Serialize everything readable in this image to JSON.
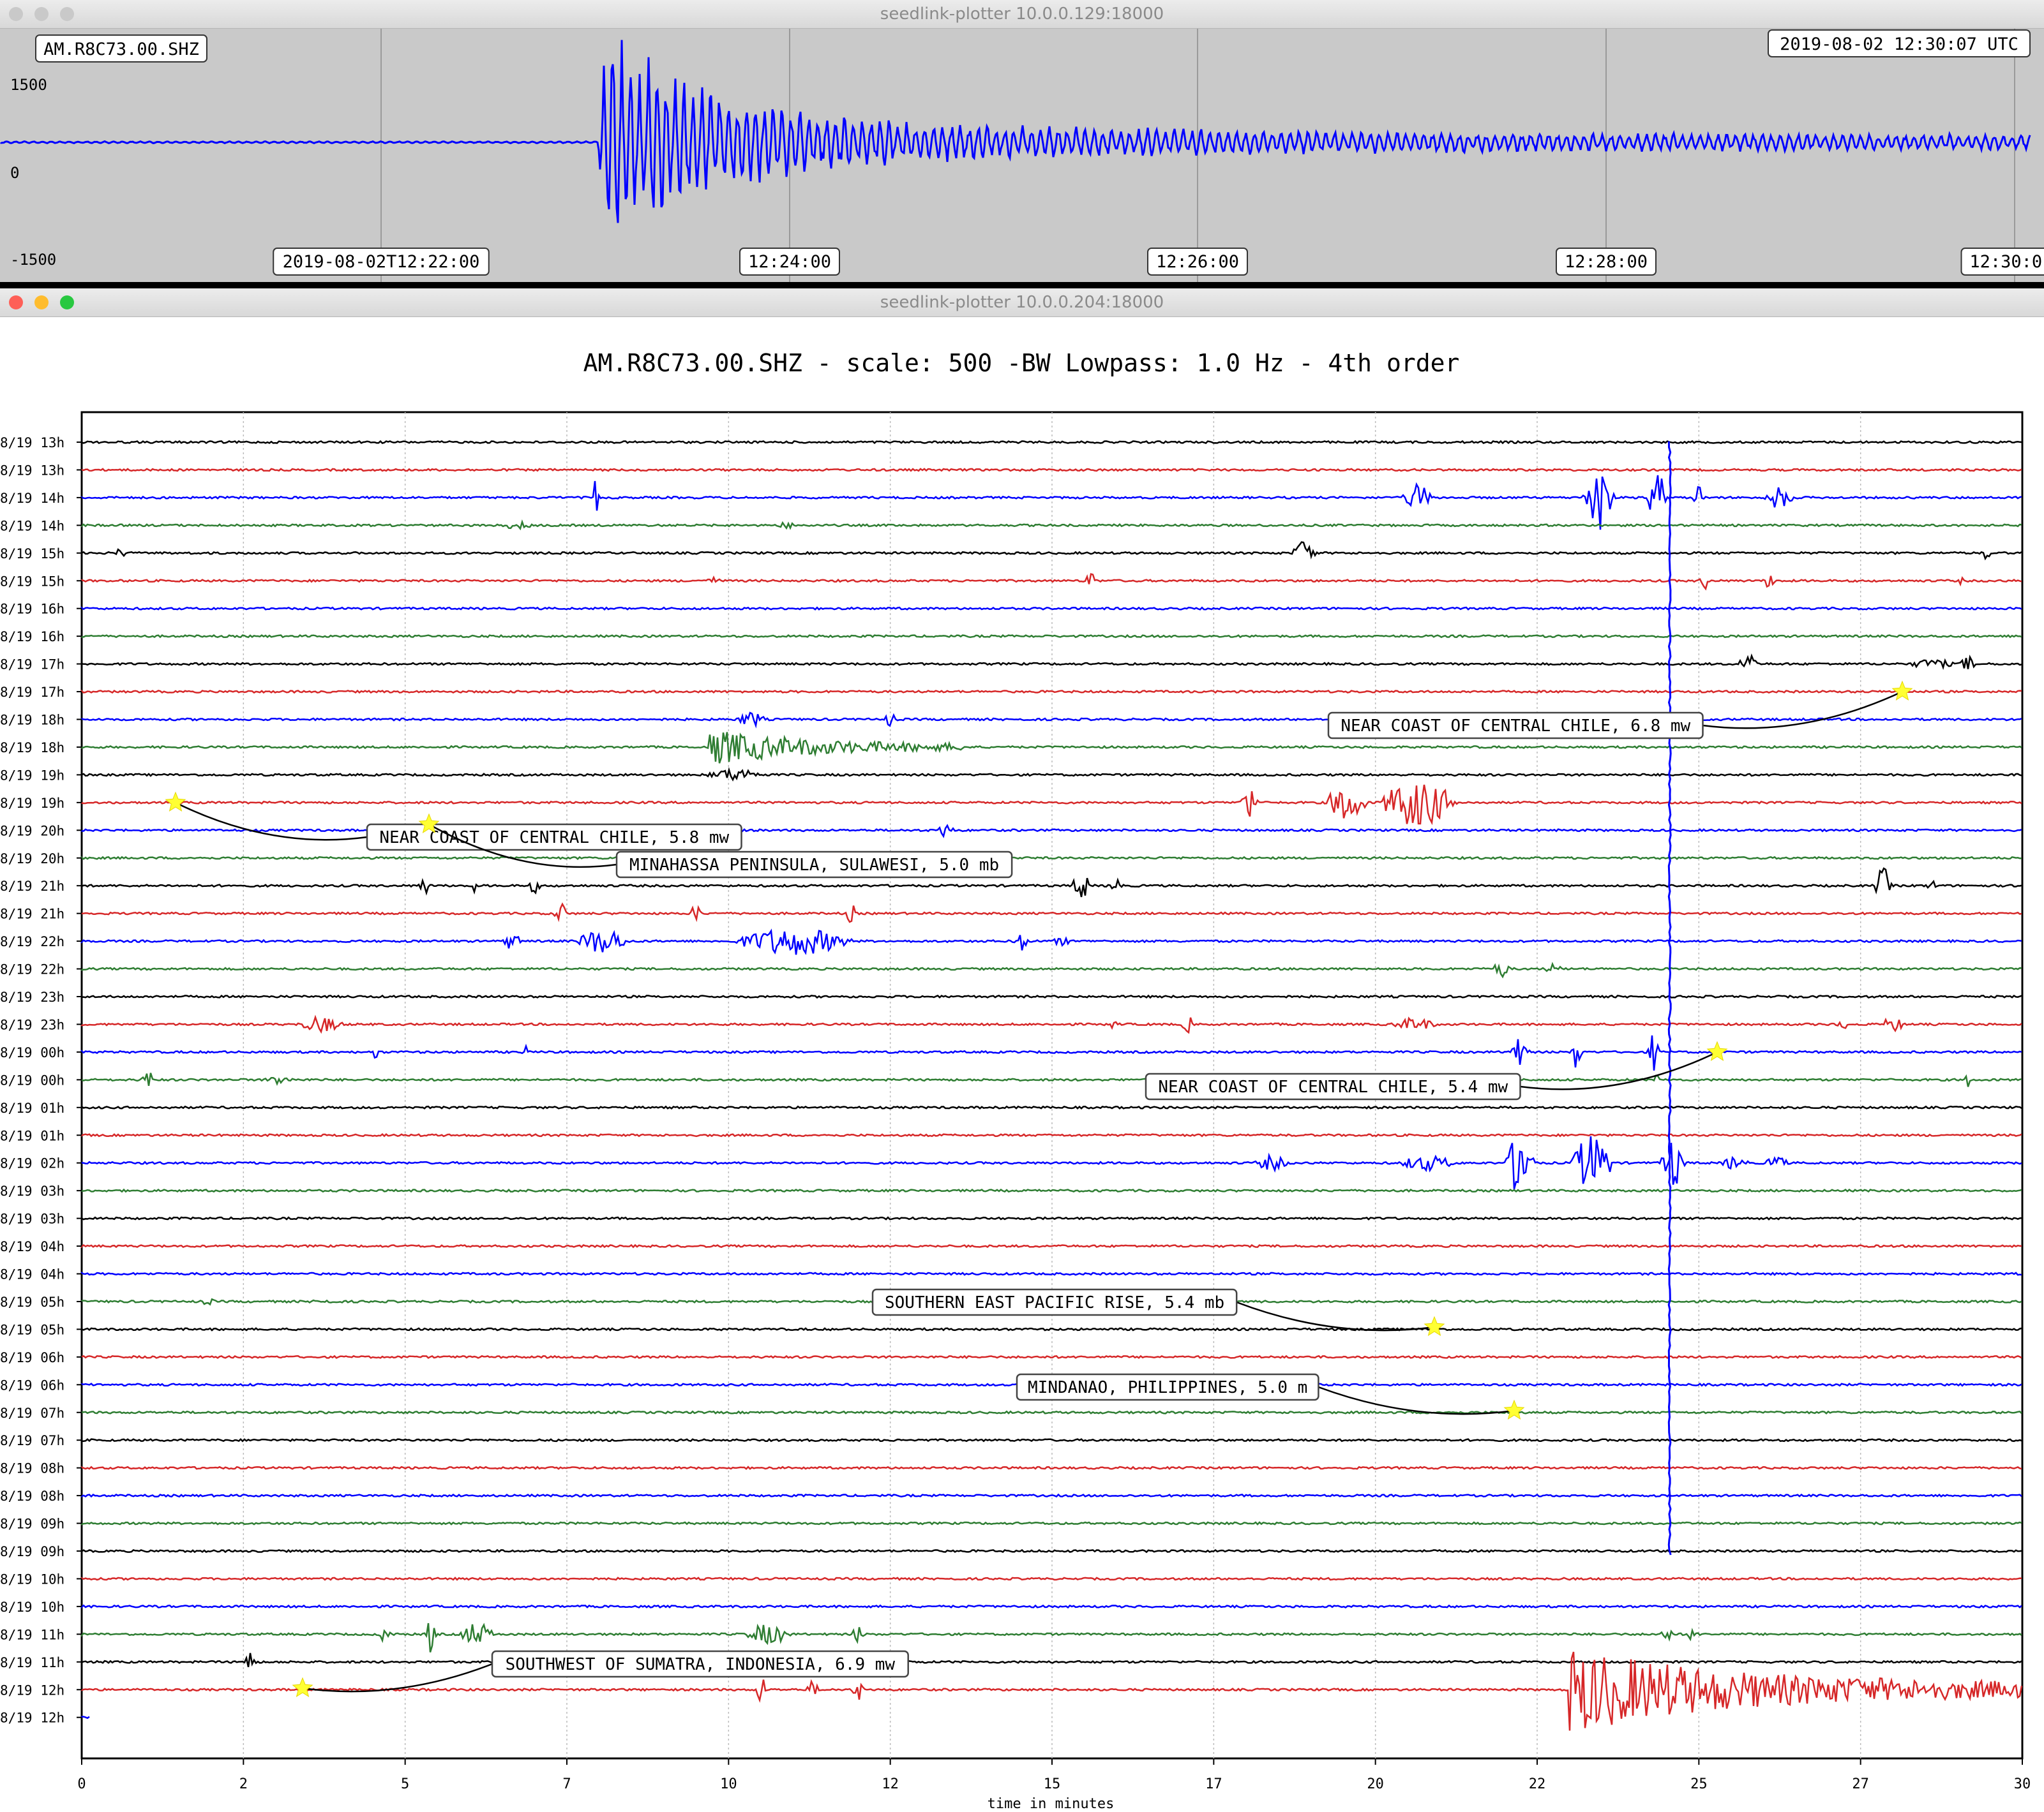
{
  "window1": {
    "title": "seedlink-plotter 10.0.0.129:18000",
    "station_label": "AM.R8C73.00.SHZ",
    "timestamp_label": "2019-08-02 12:30:07 UTC",
    "y_ticks": [
      "1500",
      "0",
      "-1500"
    ],
    "x_ticks": [
      "2019-08-02T12:22:00",
      "12:24:00",
      "12:26:00",
      "12:28:00",
      "12:30:0"
    ]
  },
  "window2": {
    "title": "seedlink-plotter 10.0.0.204:18000",
    "plot_title": "AM.R8C73.00.SHZ - scale: 500 -BW Lowpass: 1.0 Hz - 4th order",
    "x_axis_label": "time in minutes",
    "x_ticks": [
      "0",
      "2",
      "5",
      "7",
      "10",
      "12",
      "15",
      "17",
      "20",
      "22",
      "25",
      "27",
      "30"
    ],
    "row_labels": [
      "8/19 13h",
      "8/19 13h",
      "8/19 14h",
      "8/19 14h",
      "8/19 15h",
      "8/19 15h",
      "8/19 16h",
      "8/19 16h",
      "8/19 17h",
      "8/19 17h",
      "8/19 18h",
      "8/19 18h",
      "8/19 19h",
      "8/19 19h",
      "8/19 20h",
      "8/19 20h",
      "8/19 21h",
      "8/19 21h",
      "8/19 22h",
      "8/19 22h",
      "8/19 23h",
      "8/19 23h",
      "8/19 00h",
      "8/19 00h",
      "8/19 01h",
      "8/19 01h",
      "8/19 02h",
      "8/19 03h",
      "8/19 03h",
      "8/19 04h",
      "8/19 04h",
      "8/19 05h",
      "8/19 05h",
      "8/19 06h",
      "8/19 06h",
      "8/19 07h",
      "8/19 07h",
      "8/19 08h",
      "8/19 08h",
      "8/19 09h",
      "8/19 09h",
      "8/19 10h",
      "8/19 10h",
      "8/19 11h",
      "8/19 11h",
      "8/19 12h",
      "8/19 12h"
    ],
    "trace_colors": [
      "#000000",
      "#d62728",
      "#0000ff",
      "#2e7d32"
    ],
    "annotations": [
      "NEAR COAST OF CENTRAL CHILE, 6.8 mw",
      "NEAR COAST OF CENTRAL CHILE, 5.8 mw",
      "MINAHASSA PENINSULA, SULAWESI, 5.0 mb",
      "NEAR COAST OF CENTRAL CHILE, 5.4 mw",
      "SOUTHERN EAST PACIFIC RISE, 5.4 mb",
      "MINDANAO, PHILIPPINES, 5.0 m",
      "SOUTHWEST OF SUMATRA, INDONESIA, 6.9 mw"
    ]
  }
}
